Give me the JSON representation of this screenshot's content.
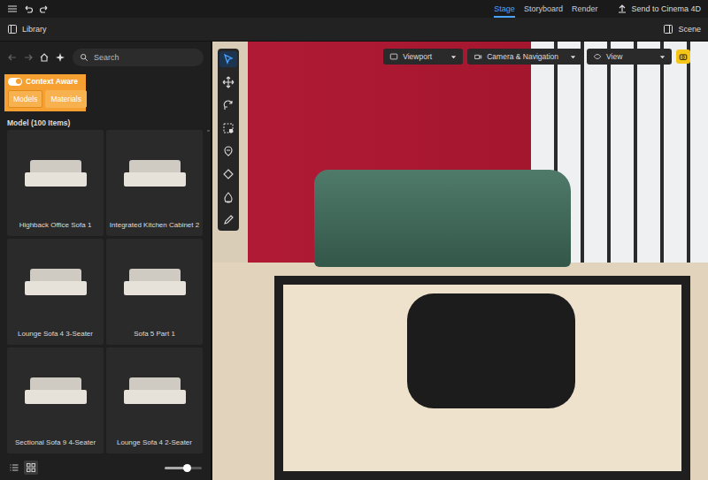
{
  "top_bar": {
    "tabs": [
      {
        "label": "Stage",
        "selected": true
      },
      {
        "label": "Storyboard",
        "selected": false
      },
      {
        "label": "Render",
        "selected": false
      }
    ],
    "send_button": "Send to Cinema 4D"
  },
  "panels": {
    "library": "Library",
    "scene": "Scene"
  },
  "search": {
    "placeholder": "Search"
  },
  "context_aware": {
    "label": "Context Aware",
    "on": true
  },
  "filters": [
    {
      "label": "Models",
      "selected": true
    },
    {
      "label": "Materials",
      "selected": false
    }
  ],
  "section_title": "Model (100 Items)",
  "models": [
    {
      "name": "Highback Office Sofa 1"
    },
    {
      "name": "Integrated Kitchen Cabinet 2"
    },
    {
      "name": "Lounge Sofa 4 3-Seater"
    },
    {
      "name": "Sofa 5 Part 1"
    },
    {
      "name": "Sectional Sofa 9 4-Seater"
    },
    {
      "name": "Lounge Sofa 4 2-Seater"
    }
  ],
  "view_modes": [
    {
      "kind": "list",
      "selected": false
    },
    {
      "kind": "grid",
      "selected": true
    }
  ],
  "thumbnail_size": {
    "level": 0.6
  },
  "viewport_menus": [
    {
      "label": "Viewport"
    },
    {
      "label": "Camera & Navigation"
    },
    {
      "label": "View"
    }
  ],
  "camera_button": {
    "on": true
  },
  "viewport_tools": [
    {
      "kind": "select",
      "selected": true
    },
    {
      "kind": "move",
      "selected": false
    },
    {
      "kind": "rotate",
      "selected": false
    },
    {
      "kind": "scale",
      "selected": false
    },
    {
      "kind": "place",
      "selected": false
    },
    {
      "kind": "fill",
      "selected": false
    },
    {
      "kind": "drop",
      "selected": false
    },
    {
      "kind": "eyedropper",
      "selected": false
    }
  ]
}
